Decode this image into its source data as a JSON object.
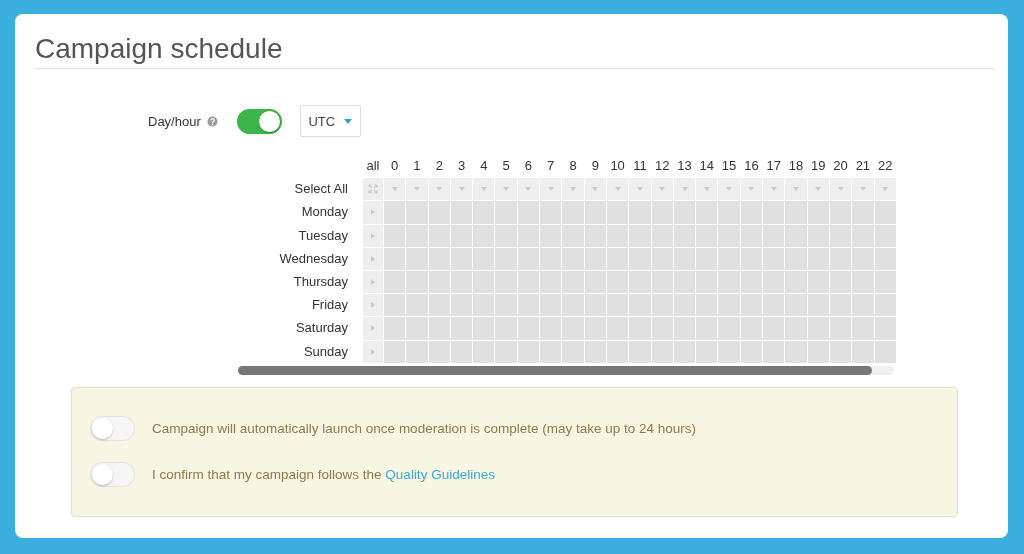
{
  "title": "Campaign schedule",
  "day_hour": {
    "label": "Day/hour",
    "on": true,
    "timezone": "UTC"
  },
  "grid": {
    "corner": "all",
    "hours": [
      "0",
      "1",
      "2",
      "3",
      "4",
      "5",
      "6",
      "7",
      "8",
      "9",
      "10",
      "11",
      "12",
      "13",
      "14",
      "15",
      "16",
      "17",
      "18",
      "19",
      "20",
      "21",
      "22"
    ],
    "select_all": "Select All",
    "days": [
      {
        "label": "Monday",
        "hours": [
          false,
          false,
          false,
          false,
          false,
          false,
          false,
          false,
          false,
          false,
          false,
          false,
          false,
          false,
          false,
          false,
          false,
          false,
          false,
          false,
          false,
          false,
          false
        ]
      },
      {
        "label": "Tuesday",
        "hours": [
          false,
          false,
          false,
          false,
          false,
          false,
          false,
          false,
          false,
          false,
          false,
          false,
          false,
          false,
          false,
          false,
          false,
          false,
          false,
          false,
          false,
          false,
          false
        ]
      },
      {
        "label": "Wednesday",
        "hours": [
          false,
          false,
          false,
          false,
          false,
          false,
          false,
          false,
          false,
          false,
          false,
          false,
          false,
          false,
          false,
          false,
          false,
          false,
          false,
          false,
          false,
          false,
          false
        ]
      },
      {
        "label": "Thursday",
        "hours": [
          false,
          false,
          false,
          false,
          false,
          false,
          false,
          false,
          false,
          false,
          false,
          false,
          false,
          false,
          false,
          false,
          false,
          false,
          false,
          false,
          false,
          false,
          false
        ]
      },
      {
        "label": "Friday",
        "hours": [
          false,
          false,
          false,
          false,
          false,
          false,
          false,
          false,
          false,
          false,
          false,
          false,
          false,
          false,
          false,
          false,
          false,
          false,
          false,
          false,
          false,
          false,
          false
        ]
      },
      {
        "label": "Saturday",
        "hours": [
          false,
          false,
          false,
          false,
          false,
          false,
          false,
          false,
          false,
          false,
          false,
          false,
          false,
          false,
          false,
          false,
          false,
          false,
          false,
          false,
          false,
          false,
          false
        ]
      },
      {
        "label": "Sunday",
        "hours": [
          false,
          false,
          false,
          false,
          false,
          false,
          false,
          false,
          false,
          false,
          false,
          false,
          false,
          false,
          false,
          false,
          false,
          false,
          false,
          false,
          false,
          false,
          false
        ]
      }
    ]
  },
  "notices": [
    {
      "text": "Campaign will automatically launch once moderation is complete (may take up to 24 hours)",
      "on": false
    },
    {
      "text": "I confirm that my campaign follows the",
      "link": "Quality Guidelines",
      "on": false
    }
  ]
}
